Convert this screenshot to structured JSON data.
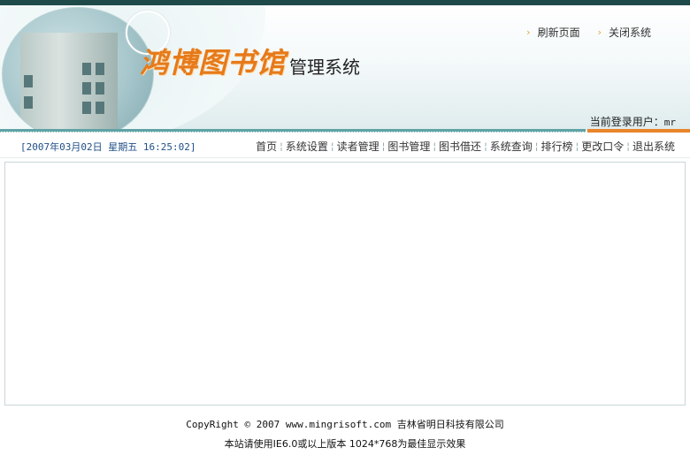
{
  "header": {
    "title_art": "鸿博图书馆",
    "title_suffix": "管理系统",
    "refresh_link": "刷新页面",
    "close_link": "关闭系统",
    "current_user_label": "当前登录用户：",
    "current_user": "mr"
  },
  "nav": {
    "datetime": "[2007年03月02日 星期五 16:25:02]",
    "menu": [
      "首页",
      "系统设置",
      "读者管理",
      "图书管理",
      "图书借还",
      "系统查询",
      "排行榜",
      "更改口令",
      "退出系统"
    ]
  },
  "footer": {
    "copyright": "CopyRight © 2007 www.mingrisoft.com 吉林省明日科技有限公司",
    "browser_note": "本站请使用IE6.0或以上版本 1024*768为最佳显示效果"
  },
  "colors": {
    "topbar": "#1f4a4a",
    "accent_orange": "#e8852a",
    "accent_teal": "#5fa3a6",
    "date_blue": "#204f87"
  }
}
